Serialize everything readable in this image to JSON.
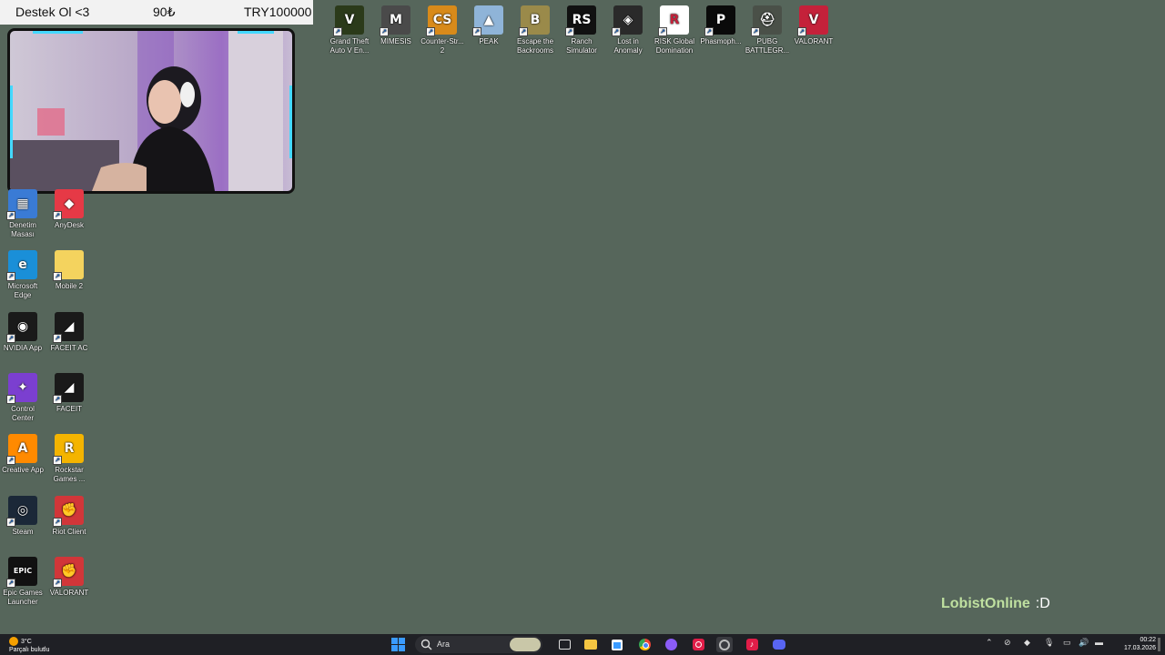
{
  "overlay": {
    "title": "Destek Ol <3",
    "amount": "90₺",
    "goal": "TRY100000"
  },
  "desktop_icons_top": [
    {
      "name": "Grand Theft Auto V En...",
      "color": "#2b3a1a",
      "glyph": "V",
      "icon": "gta-v-icon"
    },
    {
      "name": "MIMESIS",
      "color": "#4a4a4a",
      "glyph": "M",
      "icon": "mimesis-icon"
    },
    {
      "name": "Counter-Str... 2",
      "color": "#d88a1a",
      "glyph": "CS",
      "icon": "counter-strike-icon"
    },
    {
      "name": "PEAK",
      "color": "#8fb4d8",
      "glyph": "▲",
      "icon": "peak-icon"
    },
    {
      "name": "Escape the Backrooms",
      "color": "#9a8a4a",
      "glyph": "B",
      "icon": "escape-backrooms-icon"
    },
    {
      "name": "Ranch Simulator",
      "color": "#111111",
      "glyph": "RS",
      "icon": "ranch-simulator-icon"
    },
    {
      "name": "Lost in Anomaly",
      "color": "#2a2a2a",
      "glyph": "◈",
      "icon": "lost-in-anomaly-icon"
    },
    {
      "name": "RISK Global Domination",
      "color": "#ffffff",
      "glyph": "R",
      "icon": "risk-icon"
    },
    {
      "name": "Phasmoph...",
      "color": "#0a0a0a",
      "glyph": "P",
      "icon": "phasmophobia-icon"
    },
    {
      "name": "PUBG BATTLEGR...",
      "color": "#4a5048",
      "glyph": "⛑",
      "icon": "pubg-icon"
    },
    {
      "name": "VALORANT",
      "color": "#c4213a",
      "glyph": "V",
      "icon": "valorant-icon"
    }
  ],
  "desktop_icons_left": [
    {
      "name": "Denetim Masası",
      "color": "#3a7bd5",
      "glyph": "▦",
      "icon": "control-panel-icon"
    },
    {
      "name": "AnyDesk",
      "color": "#e63946",
      "glyph": "◆",
      "icon": "anydesk-icon"
    },
    {
      "name": "Microsoft Edge",
      "color": "#1a8fd8",
      "glyph": "e",
      "icon": "edge-icon"
    },
    {
      "name": "Mobile 2",
      "color": "#f4d35e",
      "glyph": "",
      "icon": "folder-icon"
    },
    {
      "name": "NVIDIA App",
      "color": "#1a1a1a",
      "glyph": "◉",
      "icon": "nvidia-icon"
    },
    {
      "name": "FACEIT AC",
      "color": "#1a1a1a",
      "glyph": "◢",
      "icon": "faceit-ac-icon"
    },
    {
      "name": "Control Center",
      "color": "#7b3fd0",
      "glyph": "✦",
      "icon": "control-center-icon"
    },
    {
      "name": "FACEIT",
      "color": "#1a1a1a",
      "glyph": "◢",
      "icon": "faceit-icon"
    },
    {
      "name": "Creative App",
      "color": "#ff8a00",
      "glyph": "A",
      "icon": "creative-app-icon"
    },
    {
      "name": "Rockstar Games ...",
      "color": "#f4b400",
      "glyph": "R",
      "icon": "rockstar-icon"
    },
    {
      "name": "Steam",
      "color": "#1b2838",
      "glyph": "◎",
      "icon": "steam-icon"
    },
    {
      "name": "Riot Client",
      "color": "#d13639",
      "glyph": "✊",
      "icon": "riot-client-icon"
    },
    {
      "name": "Epic Games Launcher",
      "color": "#111111",
      "glyph": "EPIC",
      "icon": "epic-games-icon"
    },
    {
      "name": "VALORANT",
      "color": "#d13639",
      "glyph": "✊",
      "icon": "valorant-riot-icon"
    }
  ],
  "watermark": {
    "brand": "LobistOnline",
    "face": ":D"
  },
  "taskbar": {
    "weather_temp": "3°C",
    "weather_text": "Parçalı bulutlu",
    "search_placeholder": "Ara",
    "time": "00:22",
    "date": "17.03.2026"
  }
}
